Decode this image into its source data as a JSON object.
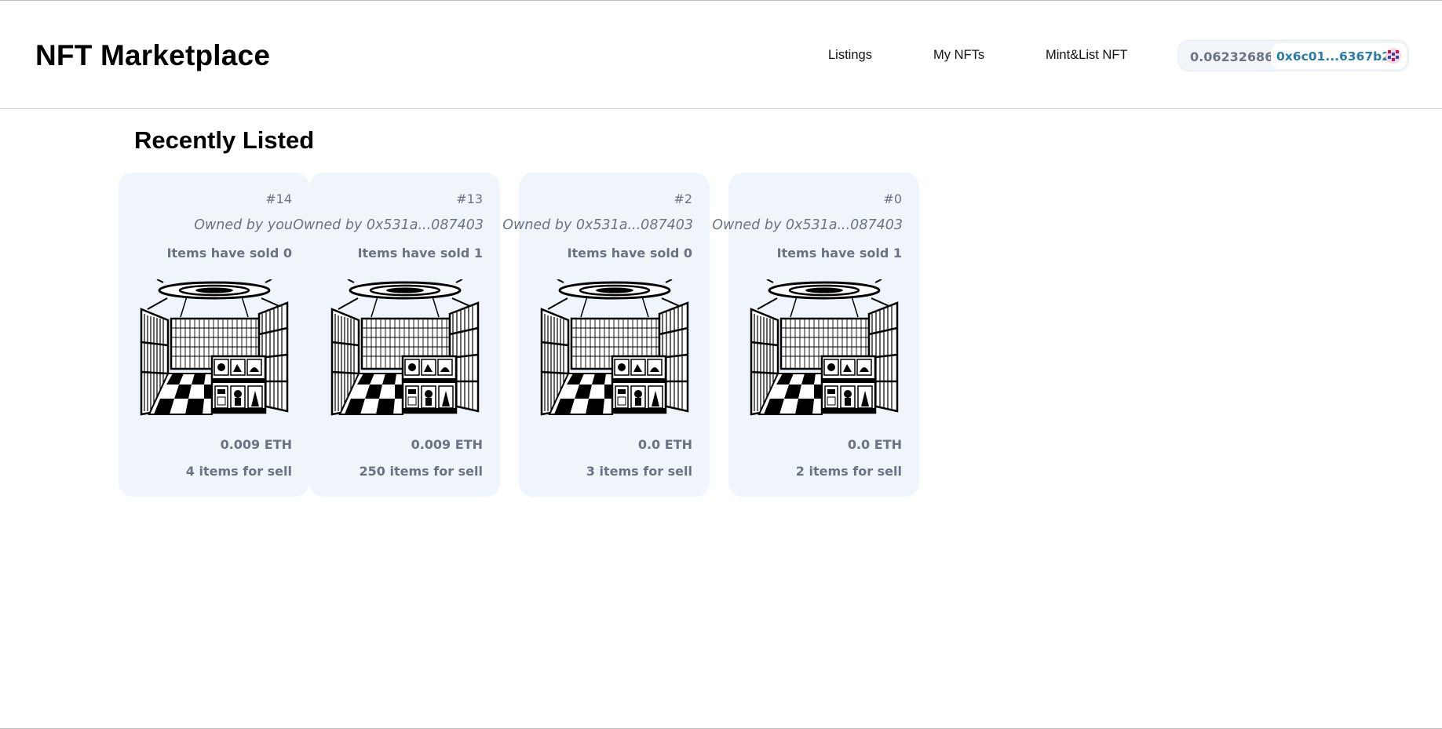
{
  "header": {
    "brand": "NFT Marketplace",
    "nav": {
      "listings": "Listings",
      "my_nfts": "My NFTs",
      "mint_list": "Mint&List NFT"
    },
    "wallet": {
      "balance": "0.06232686",
      "address": "0x6c01...6367b2",
      "avatar_icon": "identicon-avatar-icon"
    }
  },
  "main": {
    "title": "Recently Listed",
    "cards": [
      {
        "id": "#14",
        "owner": "Owned by you",
        "sold": "Items have sold 0",
        "price": "0.009 ETH",
        "stock": "4 items for sell",
        "image_icon": "bookstore-interior-image"
      },
      {
        "id": "#13",
        "owner": "Owned by 0x531a...087403",
        "sold": "Items have sold 1",
        "price": "0.009 ETH",
        "stock": "250 items for sell",
        "image_icon": "bookstore-interior-image"
      },
      {
        "id": "#2",
        "owner": "Owned by 0x531a...087403",
        "sold": "Items have sold 0",
        "price": "0.0 ETH",
        "stock": "3 items for sell",
        "image_icon": "bookstore-interior-image"
      },
      {
        "id": "#0",
        "owner": "Owned by 0x531a...087403",
        "sold": "Items have sold 1",
        "price": "0.0 ETH",
        "stock": "2 items for sell",
        "image_icon": "bookstore-interior-image"
      }
    ]
  },
  "colors": {
    "card_background": "#f0f5fc",
    "muted_text": "#6b7280",
    "address_text": "#2b7aa8",
    "wallet_background": "#f1f5f9"
  }
}
